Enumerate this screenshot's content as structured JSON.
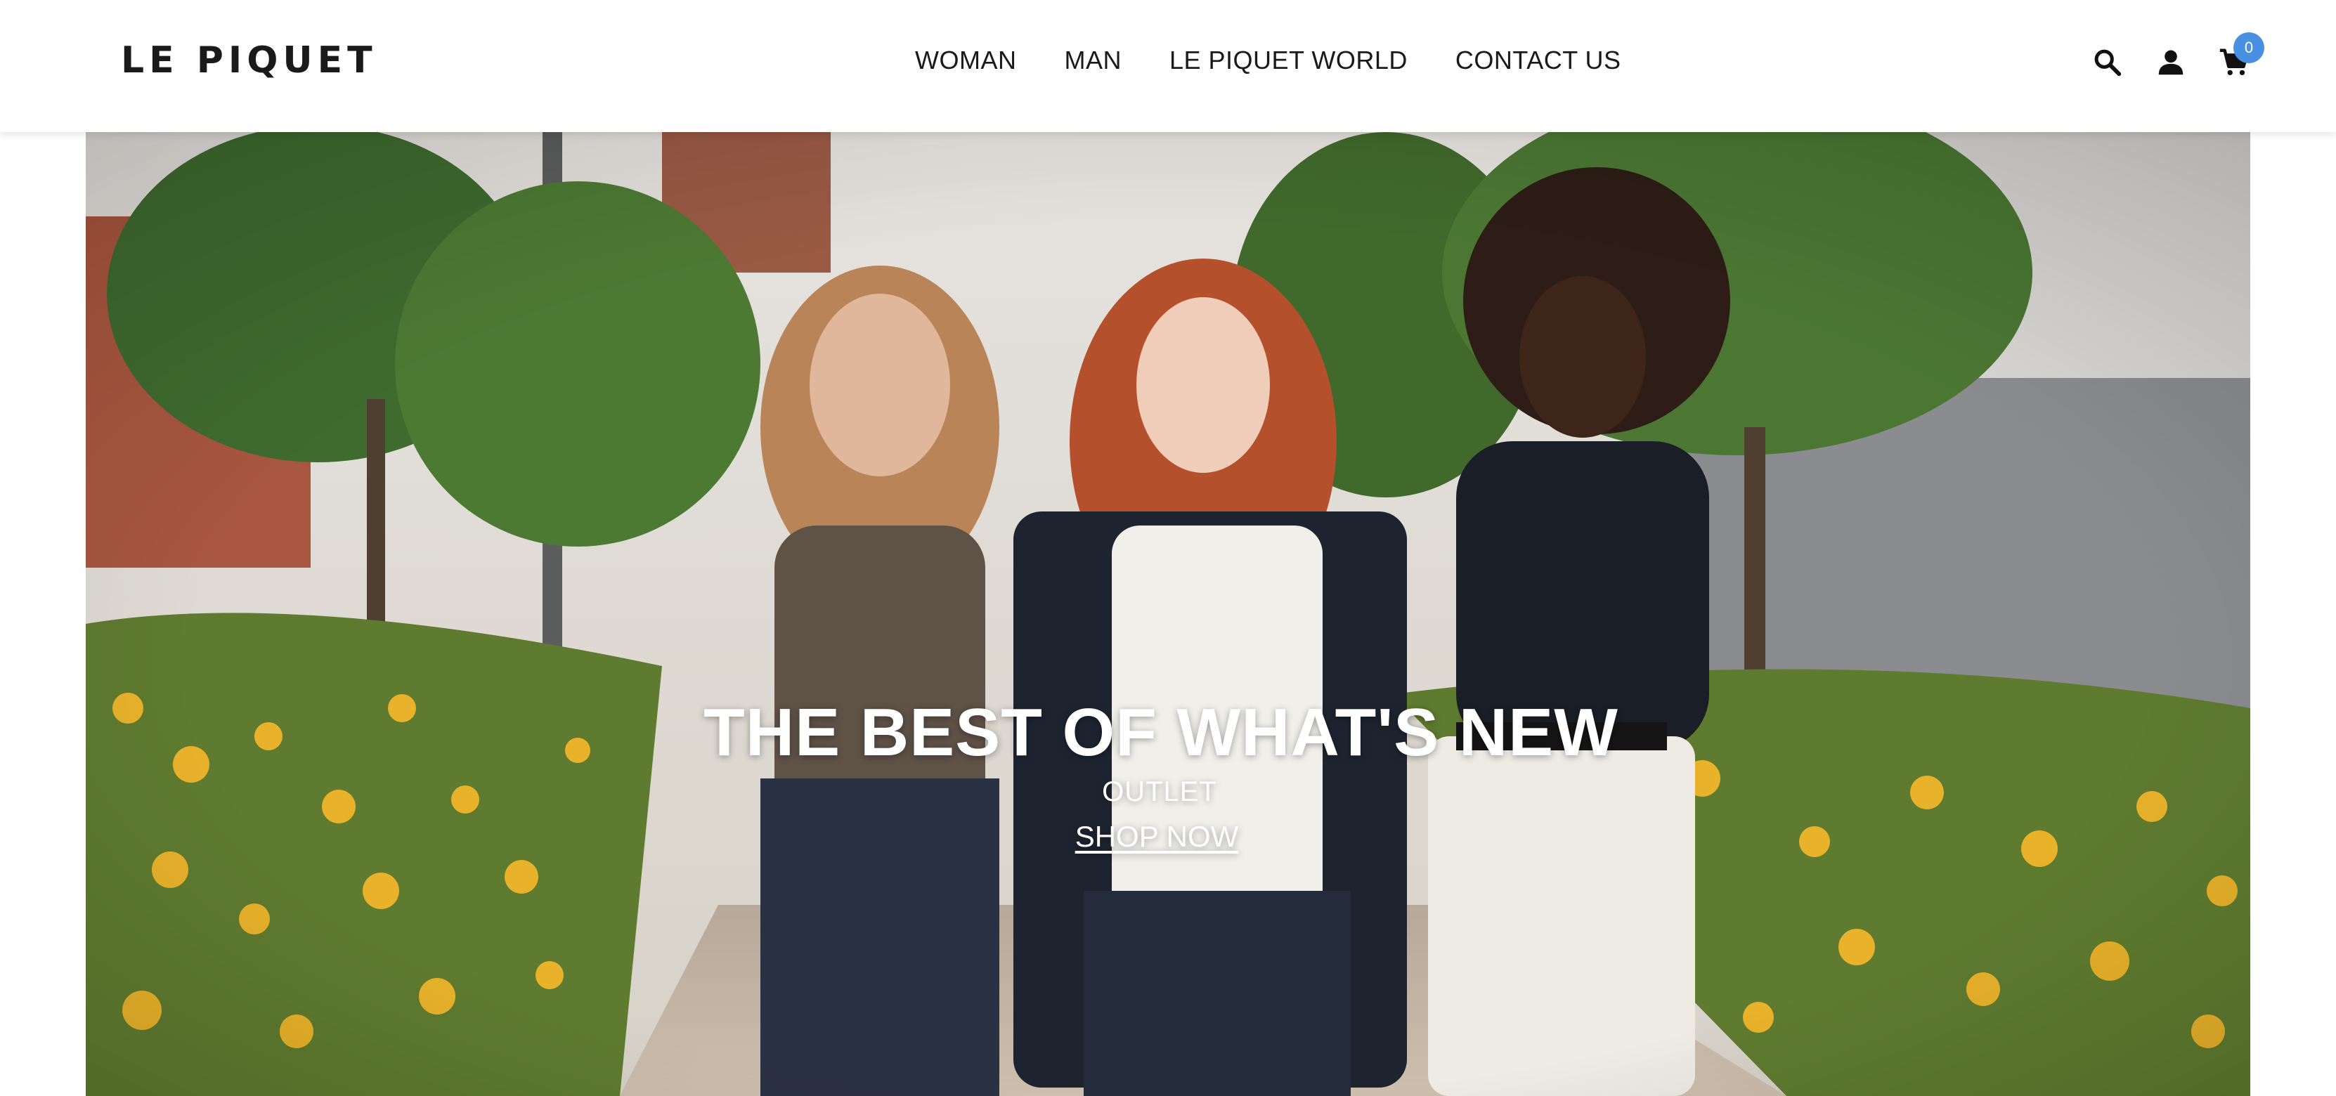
{
  "header": {
    "logo_text": "LE PIQUET",
    "nav": [
      {
        "label": "WOMAN"
      },
      {
        "label": "MAN"
      },
      {
        "label": "LE PIQUET WORLD"
      },
      {
        "label": "CONTACT US"
      }
    ],
    "icons": {
      "search": "search-icon",
      "account": "user-icon",
      "cart": "cart-icon"
    },
    "cart_count": "0",
    "badge_color": "#4a90e2"
  },
  "hero": {
    "title": "THE BEST OF WHAT'S NEW",
    "subtitle": "OUTLET",
    "cta": "SHOP NOW",
    "image_description": "three-women-walking-on-path-with-yellow-flowers"
  }
}
